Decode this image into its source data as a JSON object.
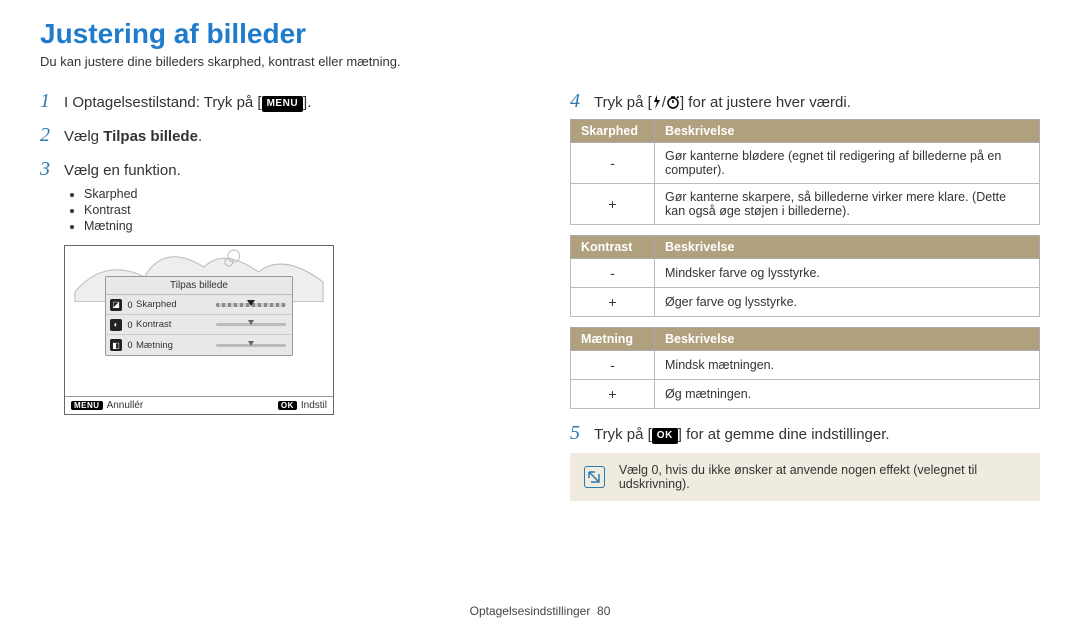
{
  "header": {
    "title": "Justering af billeder",
    "subtitle": "Du kan justere dine billeders skarphed, kontrast eller mætning."
  },
  "left": {
    "step1_prefix": "I Optagelsestilstand: Tryk på [",
    "step1_suffix": "].",
    "menu_badge": "MENU",
    "step2_prefix": "Vælg ",
    "step2_bold": "Tilpas billede",
    "step2_suffix": ".",
    "step3": "Vælg en funktion.",
    "bullets": [
      "Skarphed",
      "Kontrast",
      "Mætning"
    ],
    "preview": {
      "panel_title": "Tilpas billede",
      "rows": [
        {
          "icon": "◪",
          "zero": "0",
          "label": "Skarphed",
          "slider": "big"
        },
        {
          "icon": "◐",
          "zero": "0",
          "label": "Kontrast",
          "slider": "small"
        },
        {
          "icon": "◧",
          "zero": "0",
          "label": "Mætning",
          "slider": "small"
        }
      ],
      "footer_left_badge": "MENU",
      "footer_left_text": "Annullér",
      "footer_right_badge": "OK",
      "footer_right_text": "Indstil"
    }
  },
  "right": {
    "step4_prefix": "Tryk på [",
    "step4_mid": "/",
    "step4_suffix": "] for at justere hver værdi.",
    "tables": [
      {
        "head1": "Skarphed",
        "head2": "Beskrivelse",
        "rows": [
          {
            "sign": "-",
            "desc": "Gør kanterne blødere (egnet til redigering af billederne på en computer)."
          },
          {
            "sign": "+",
            "desc": "Gør kanterne skarpere, så billederne virker mere klare. (Dette kan også øge støjen i billederne)."
          }
        ]
      },
      {
        "head1": "Kontrast",
        "head2": "Beskrivelse",
        "rows": [
          {
            "sign": "-",
            "desc": "Mindsker farve og lysstyrke."
          },
          {
            "sign": "+",
            "desc": "Øger farve og lysstyrke."
          }
        ]
      },
      {
        "head1": "Mætning",
        "head2": "Beskrivelse",
        "rows": [
          {
            "sign": "-",
            "desc": "Mindsk mætningen."
          },
          {
            "sign": "+",
            "desc": "Øg mætningen."
          }
        ]
      }
    ],
    "step5_prefix": "Tryk på [",
    "step5_badge": "OK",
    "step5_suffix": "] for at gemme dine indstillinger.",
    "note": "Vælg 0, hvis du ikke ønsker at anvende nogen effekt (velegnet til udskrivning)."
  },
  "footer": {
    "section": "Optagelsesindstillinger",
    "page": "80"
  }
}
